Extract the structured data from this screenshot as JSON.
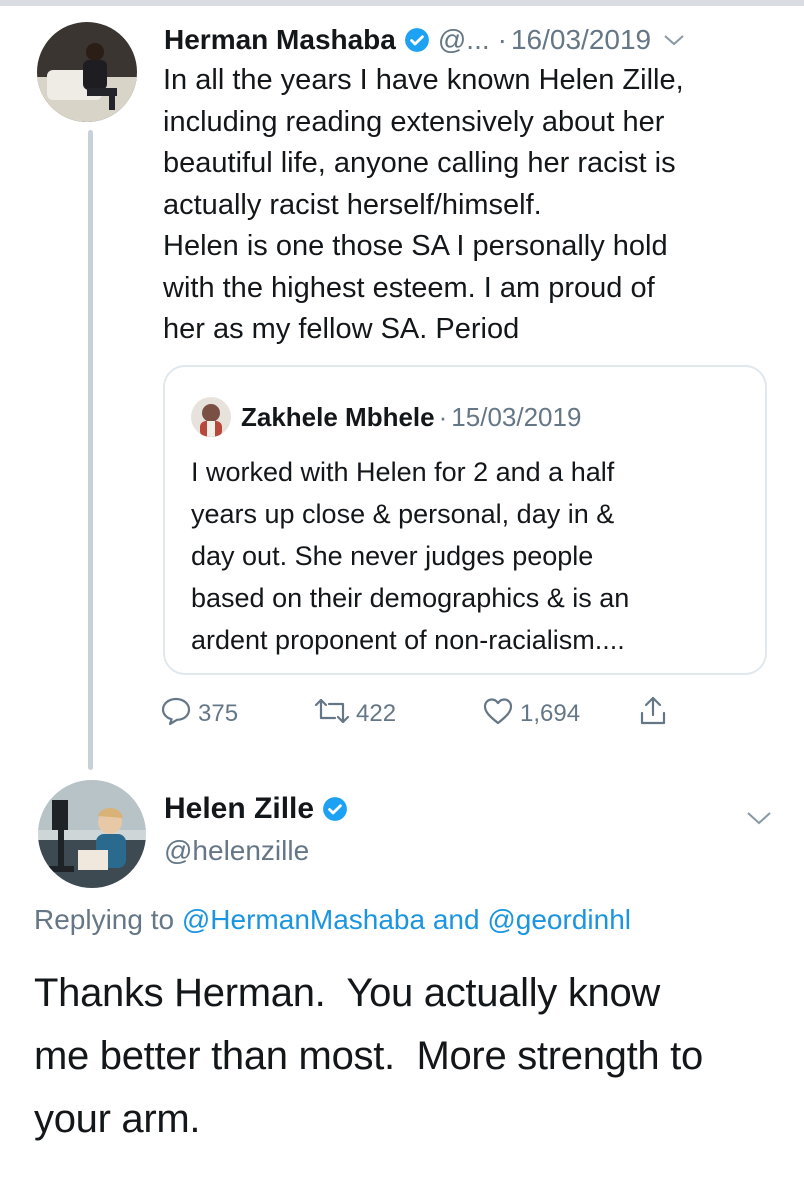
{
  "colors": {
    "text": "#14171a",
    "secondary": "#657786",
    "link": "#1b95e0",
    "verified": "#1da1f2",
    "border": "#e1e8ed",
    "thread_line": "#c9d1d8"
  },
  "tweet": {
    "author_name": "Herman Mashaba",
    "handle": "@...",
    "separator": "·",
    "date": "16/03/2019",
    "verified_icon": "verified-badge-icon",
    "lines": [
      "In all the years I have known Helen Zille,",
      "including reading extensively about her",
      "beautiful life, anyone calling her racist is",
      "actually racist herself/himself.",
      "Helen is one those SA I personally hold",
      "with the highest esteem. I am proud of",
      "her as my fellow SA. Period"
    ],
    "quote": {
      "author_name": "Zakhele Mbhele",
      "separator": "·",
      "date": "15/03/2019",
      "lines": [
        "I worked with Helen for 2 and a half",
        "years up close & personal, day in &",
        "day out. She never judges people",
        "based on their demographics & is an",
        "ardent proponent of non-racialism...."
      ]
    },
    "actions": {
      "replies": "375",
      "retweets": "422",
      "likes": "1,694",
      "reply_icon": "reply-icon",
      "retweet_icon": "retweet-icon",
      "like_icon": "heart-icon",
      "share_icon": "share-icon"
    }
  },
  "reply": {
    "author_name": "Helen Zille",
    "handle": "@helenzille",
    "replying_prefix": "Replying to",
    "replying_user_1": "@HermanMashaba",
    "replying_and": "and",
    "replying_user_2": "@geordinhl",
    "lines": [
      "Thanks Herman.  You actually know",
      "me better than most.  More strength to",
      "your arm."
    ]
  }
}
